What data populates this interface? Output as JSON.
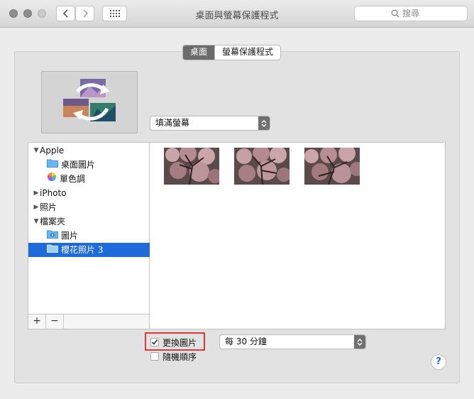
{
  "window": {
    "title": "桌面與螢幕保護程式"
  },
  "search": {
    "placeholder": "搜尋"
  },
  "tabs": [
    {
      "label": "桌面",
      "selected": true
    },
    {
      "label": "螢幕保護程式",
      "selected": false
    }
  ],
  "fill_mode": {
    "value": "填滿螢幕"
  },
  "sidebar": {
    "items": [
      {
        "label": "Apple",
        "expanded": true,
        "level": 0
      },
      {
        "label": "桌面圖片",
        "level": 1,
        "icon": "folder-icon"
      },
      {
        "label": "單色調",
        "level": 1,
        "icon": "color-wheel-icon"
      },
      {
        "label": "iPhoto",
        "expanded": false,
        "level": 0
      },
      {
        "label": "照片",
        "expanded": false,
        "level": 0
      },
      {
        "label": "檔案夾",
        "expanded": true,
        "level": 0
      },
      {
        "label": "圖片",
        "level": 1,
        "icon": "camera-folder-icon"
      },
      {
        "label": "櫻花照片 3",
        "level": 1,
        "icon": "folder-icon",
        "selected": true
      }
    ],
    "add_label": "+",
    "remove_label": "−"
  },
  "change_picture": {
    "label": "更換圖片",
    "checked": true
  },
  "interval": {
    "value": "每 30 分鐘"
  },
  "random_order": {
    "label": "隨機順序",
    "checked": false
  },
  "help": {
    "label": "?"
  },
  "colors": {
    "selection": "#1e6bd9",
    "highlight": "#e03838"
  }
}
